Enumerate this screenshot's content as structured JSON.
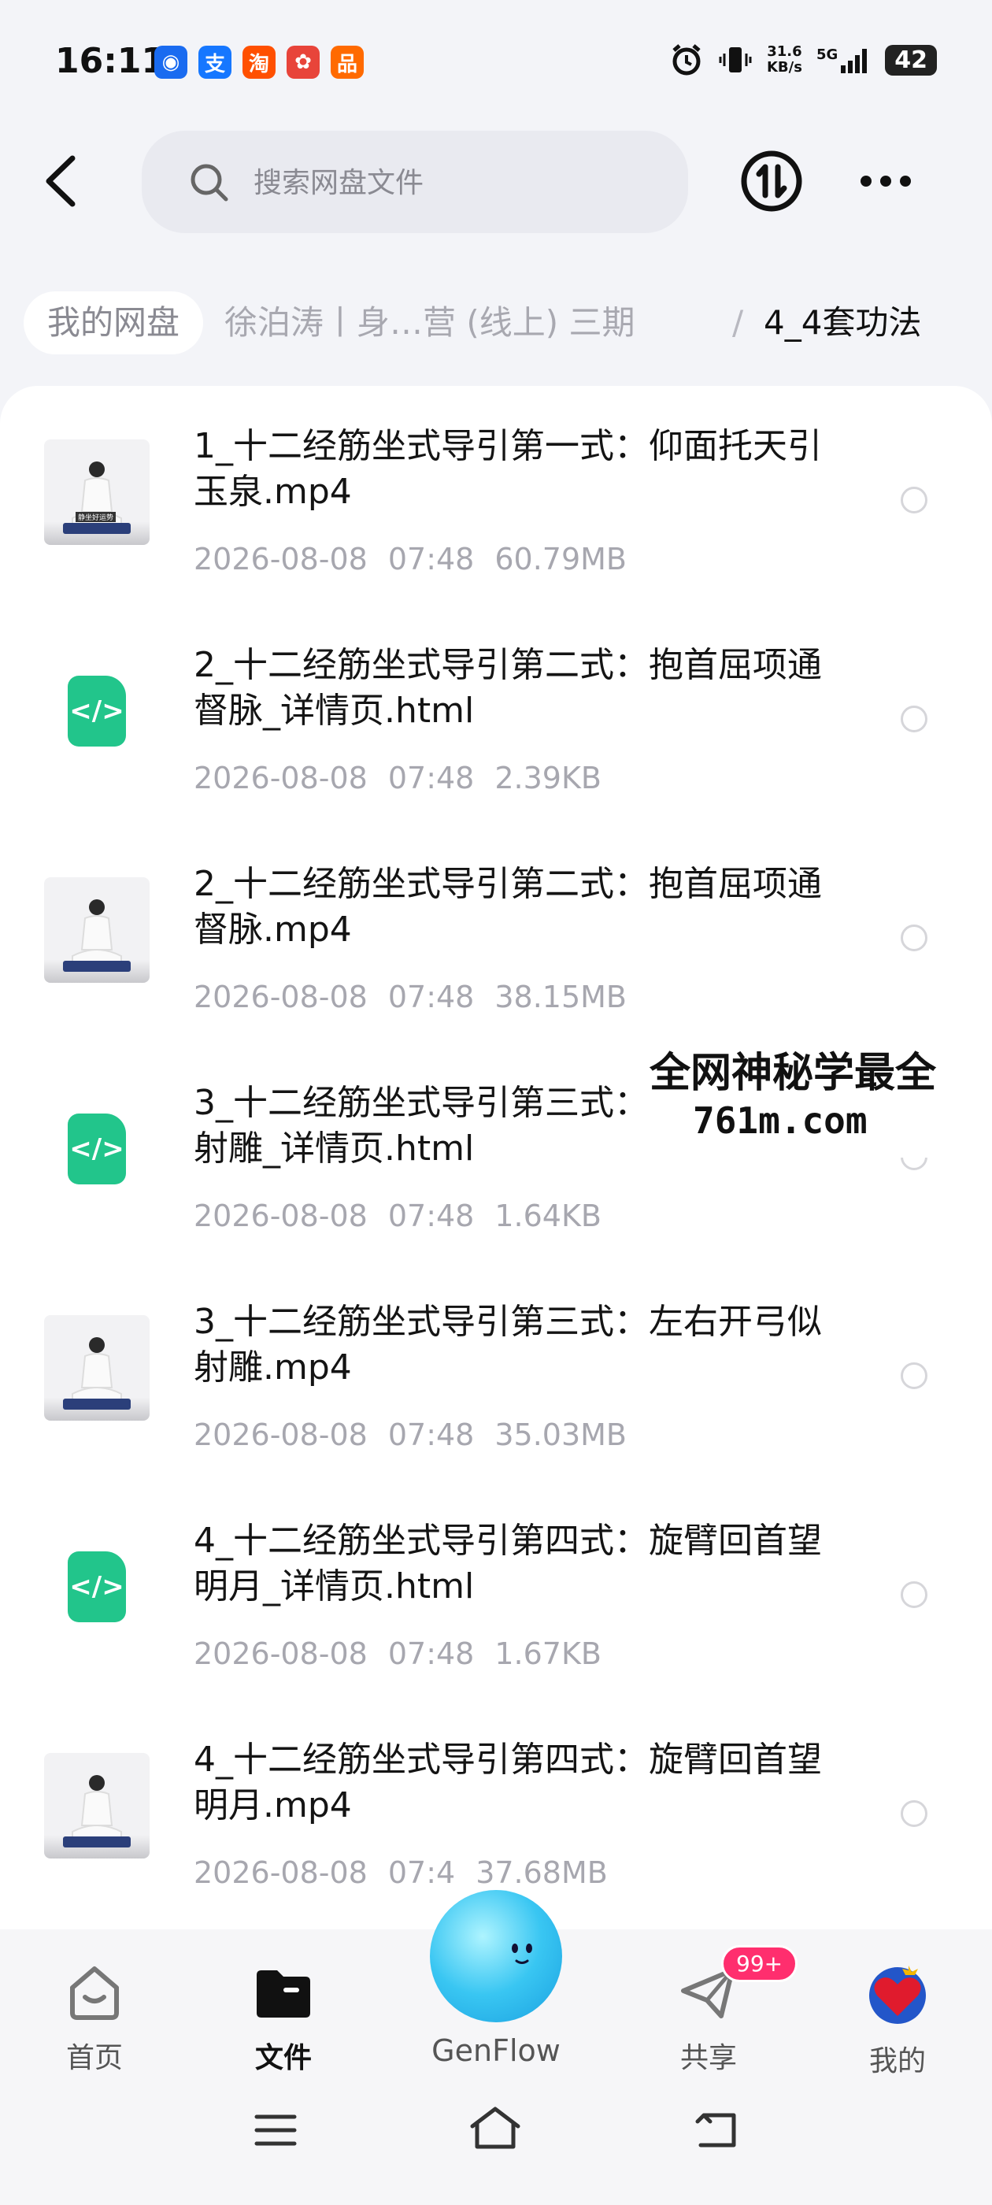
{
  "status_bar": {
    "time": "16:11",
    "apps": [
      {
        "name": "pay-app-icon",
        "glyph": "◉",
        "color": "#1a6bf0"
      },
      {
        "name": "alipay-icon",
        "glyph": "支",
        "color": "#1677ff"
      },
      {
        "name": "taobao-icon",
        "glyph": "淘",
        "color": "#ff5000"
      },
      {
        "name": "app-icon",
        "glyph": "✿",
        "color": "#e8443a"
      },
      {
        "name": "app-icon",
        "glyph": "品",
        "color": "#ff6a00"
      }
    ],
    "net_speed": "31.6",
    "net_unit": "KB/s",
    "network": "5G",
    "battery": "42"
  },
  "header": {
    "search_placeholder": "搜索网盘文件"
  },
  "breadcrumb": {
    "home": "我的网盘",
    "middle": "徐泊涛丨身…营 (线上) 三期",
    "separator": "/",
    "current": "4_4套功法"
  },
  "files": [
    {
      "name": "1_十二经筋坐式导引第一式：仰面托天引玉泉.mp4",
      "date": "2026-08-08",
      "time": "07:48",
      "size": "60.79MB",
      "type": "video",
      "thumb_caption": "静坐好运势"
    },
    {
      "name": "2_十二经筋坐式导引第二式：抱首屈项通督脉_详情页.html",
      "date": "2026-08-08",
      "time": "07:48",
      "size": "2.39KB",
      "type": "html"
    },
    {
      "name": "2_十二经筋坐式导引第二式：抱首屈项通督脉.mp4",
      "date": "2026-08-08",
      "time": "07:48",
      "size": "38.15MB",
      "type": "video"
    },
    {
      "name": "3_十二经筋坐式导引第三式：左右开弓似射雕_详情页.html",
      "date": "2026-08-08",
      "time": "07:48",
      "size": "1.64KB",
      "type": "html"
    },
    {
      "name": "3_十二经筋坐式导引第三式：左右开弓似射雕.mp4",
      "date": "2026-08-08",
      "time": "07:48",
      "size": "35.03MB",
      "type": "video"
    },
    {
      "name": "4_十二经筋坐式导引第四式：旋臂回首望明月_详情页.html",
      "date": "2026-08-08",
      "time": "07:48",
      "size": "1.67KB",
      "type": "html"
    },
    {
      "name": "4_十二经筋坐式导引第四式：旋臂回首望明月.mp4",
      "date": "2026-08-08",
      "time": "07:4",
      "size": "37.68MB",
      "type": "video"
    }
  ],
  "watermark": {
    "line1": "全网神秘学最全",
    "line2": "761m.com"
  },
  "nav": {
    "home": "首页",
    "files": "文件",
    "genflow": "GenFlow",
    "share": "共享",
    "share_badge": "99+",
    "me": "我的"
  },
  "colors": {
    "html_badge": "#22c58b",
    "badge": "#ff2e6e",
    "genflow_orb": "#39c6f2"
  }
}
